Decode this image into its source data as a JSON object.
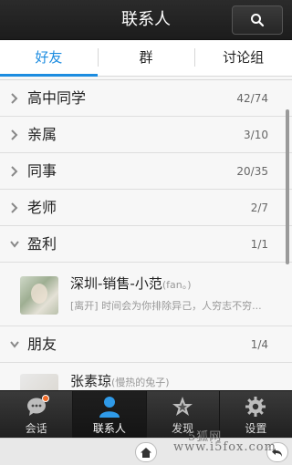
{
  "header": {
    "title": "联系人"
  },
  "tabs": [
    {
      "label": "好友"
    },
    {
      "label": "群"
    },
    {
      "label": "讨论组"
    }
  ],
  "groups": [
    {
      "name": "高中同学",
      "count": "42/74"
    },
    {
      "name": "亲属",
      "count": "3/10"
    },
    {
      "name": "同事",
      "count": "20/35"
    },
    {
      "name": "老师",
      "count": "2/7"
    },
    {
      "name": "盈利",
      "count": "1/1"
    },
    {
      "name": "朋友",
      "count": "1/4"
    }
  ],
  "contacts": [
    {
      "name": "深圳-销售-小范",
      "nick": "(fan。)",
      "status": "[离开] 时间会为你排除异己，人穷志不穷..."
    },
    {
      "name": "张素琼",
      "nick": "(慢热的兔子)"
    }
  ],
  "bottom_nav": [
    {
      "label": "会话"
    },
    {
      "label": "联系人"
    },
    {
      "label": "发现"
    },
    {
      "label": "设置"
    }
  ],
  "watermark": {
    "line1": "5狐网",
    "line2": "www.i5fox.com"
  },
  "colors": {
    "accent": "#1c8ce0",
    "badge": "#f06a26"
  }
}
